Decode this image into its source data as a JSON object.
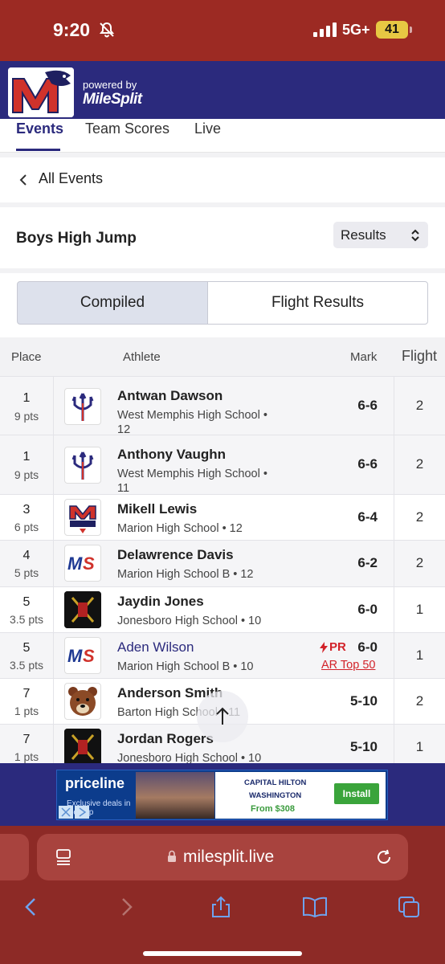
{
  "status_bar": {
    "time": "9:20",
    "network": "5G+",
    "battery": "41"
  },
  "header": {
    "powered_by": "powered by",
    "brand": "MileSplit",
    "logo_letter": "M"
  },
  "tabs": [
    {
      "label": "Events",
      "active": true
    },
    {
      "label": "Team Scores",
      "active": false
    },
    {
      "label": "Live",
      "active": false
    }
  ],
  "nav": {
    "back_label": "All Events"
  },
  "event": {
    "title": "Boys High Jump",
    "view_select": "Results"
  },
  "view_toggle": {
    "compiled": "Compiled",
    "flight_results": "Flight Results",
    "selected": "Compiled"
  },
  "table": {
    "headers": {
      "place": "Place",
      "athlete": "Athlete",
      "mark": "Mark",
      "flight": "Flight"
    },
    "rows": [
      {
        "place": "1",
        "points": "9 pts",
        "name": "Antwan Dawson",
        "school_line1": "West Memphis High School •",
        "school_line2": "12",
        "mark": "6-6",
        "flight": "2",
        "logo": "trident"
      },
      {
        "place": "1",
        "points": "9 pts",
        "name": "Anthony Vaughn",
        "school_line1": "West Memphis High School •",
        "school_line2": "11",
        "mark": "6-6",
        "flight": "2",
        "logo": "trident"
      },
      {
        "place": "3",
        "points": "6 pts",
        "name": "Mikell Lewis",
        "school_line1": "Marion High School • 12",
        "school_line2": "",
        "mark": "6-4",
        "flight": "2",
        "logo": "marion-track"
      },
      {
        "place": "4",
        "points": "5 pts",
        "name": "Delawrence Davis",
        "school_line1": "Marion High School B • 12",
        "school_line2": "",
        "mark": "6-2",
        "flight": "2",
        "logo": "ms"
      },
      {
        "place": "5",
        "points": "3.5 pts",
        "name": "Jaydin Jones",
        "school_line1": "Jonesboro High School • 10",
        "school_line2": "",
        "mark": "6-0",
        "flight": "1",
        "logo": "jonesboro"
      },
      {
        "place": "5",
        "points": "3.5 pts",
        "name": "Aden Wilson",
        "school_line1": "Marion High School B • 10",
        "school_line2": "",
        "mark": "6-0",
        "flight": "1",
        "logo": "ms",
        "pr": "PR",
        "award": "AR Top 50"
      },
      {
        "place": "7",
        "points": "1 pts",
        "name": "Anderson Smith",
        "school_line1": "Barton High School • 11",
        "school_line2": "",
        "mark": "5-10",
        "flight": "2",
        "logo": "bear"
      },
      {
        "place": "7",
        "points": "1 pts",
        "name": "Jordan Rogers",
        "school_line1": "Jonesboro High School • 10",
        "school_line2": "",
        "mark": "5-10",
        "flight": "1",
        "logo": "jonesboro"
      }
    ]
  },
  "ad": {
    "brand": "priceline",
    "tagline": "Exclusive deals in the app",
    "hotel_line1": "CAPITAL HILTON",
    "hotel_line2": "WASHINGTON",
    "price": "From $308",
    "cta": "Install"
  },
  "browser": {
    "url": "milesplit.live"
  },
  "colors": {
    "navy": "#2b2a7d",
    "status_red": "#9c2a23",
    "pr_red": "#d2232a"
  }
}
